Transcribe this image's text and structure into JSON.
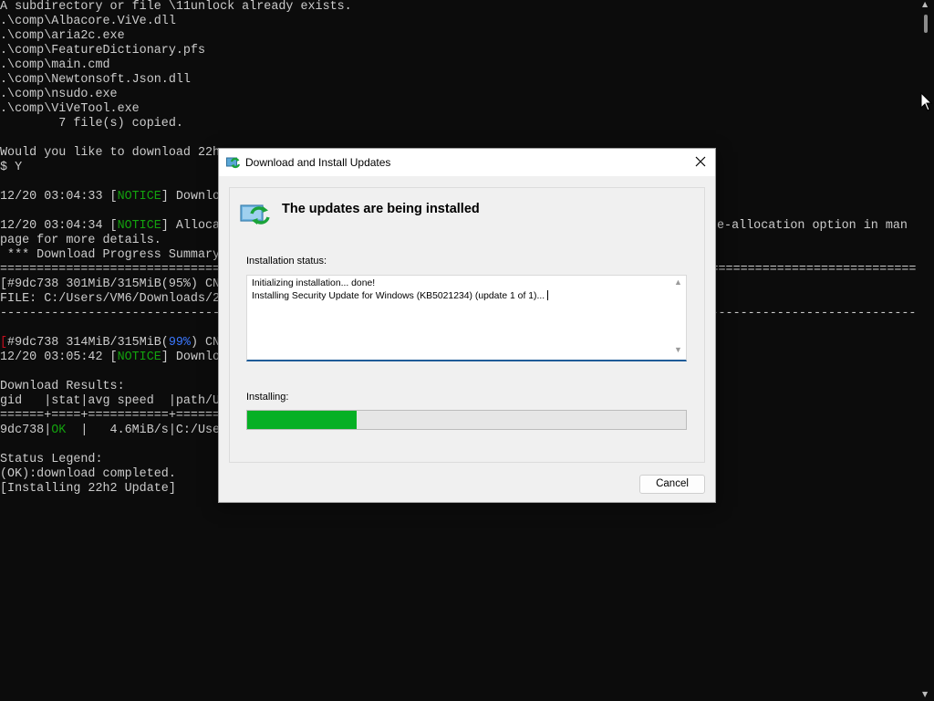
{
  "console": {
    "lines": [
      "A subdirectory or file \\11unlock already exists.",
      ".\\comp\\Albacore.ViVe.dll",
      ".\\comp\\aria2c.exe",
      ".\\comp\\FeatureDictionary.pfs",
      ".\\comp\\main.cmd",
      ".\\comp\\Newtonsoft.Json.dll",
      ".\\comp\\nsudo.exe",
      ".\\comp\\ViVeTool.exe",
      "        7 file(s) copied.",
      "Would you like to download 22h",
      "$ Y",
      "12/20 03:04:34 [",
      "NOTICE",
      "] Alloca",
      "e-allocation option in man",
      "page for more details.",
      " *** Download Progress Summary",
      "[#9dc738 301MiB/315MiB(95%) CN",
      "FILE: C:/Users/VM6/Downloads/2",
      "[",
      "#9dc738 314MiB/315MiB(",
      "99%",
      ") CN",
      "12/20 03:05:42 [",
      "] Downlo",
      "Download Results:",
      "gid   |stat|avg speed  |path/U",
      "======+====+===========+======",
      "9dc738|",
      "OK",
      "  |   4.6MiB/s|C:/Use",
      "Status Legend:",
      "(OK):download completed.",
      "[Installing 22h2 Update]",
      "12/20 03:04:33 ["
    ]
  },
  "dialog": {
    "title": "Download and Install Updates",
    "heading": "The updates are being installed",
    "status_label": "Installation status:",
    "status_lines": [
      "Initializing installation... done!",
      "Installing Security Update for Windows (KB5021234) (update 1 of 1)..."
    ],
    "installing_label": "Installing:",
    "progress_fraction": 0.25,
    "cancel_label": "Cancel",
    "icons": {
      "title": "windows-update-icon",
      "header": "windows-update-icon",
      "close": "close-icon"
    }
  },
  "colors": {
    "console_bg": "#0c0c0c",
    "console_text": "#cccccc",
    "notice_green": "#13a10e",
    "percent_blue": "#3b78ff",
    "bracket_red": "#c50f1f",
    "progress_green": "#06b025",
    "status_box_underline": "#1f5c99"
  }
}
